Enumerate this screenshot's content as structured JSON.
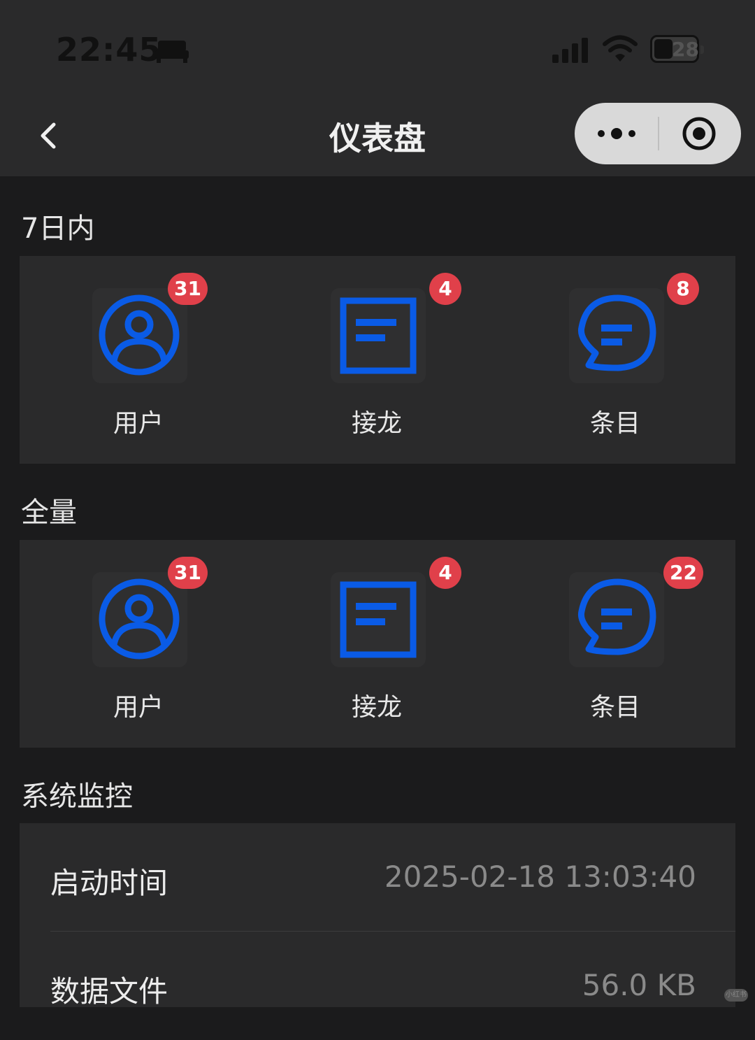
{
  "status_bar": {
    "time": "22:45",
    "battery_level": "28",
    "icons": [
      "bed-icon",
      "signal-icon",
      "wifi-icon",
      "battery-icon"
    ]
  },
  "nav": {
    "title": "仪表盘",
    "back_icon": "chevron-left-icon",
    "more_icon": "more-dots-icon",
    "close_icon": "target-icon"
  },
  "sections": [
    {
      "title": "7日内",
      "cards": [
        {
          "label": "用户",
          "badge": "31",
          "icon": "user-icon"
        },
        {
          "label": "接龙",
          "badge": "4",
          "icon": "document-icon"
        },
        {
          "label": "条目",
          "badge": "8",
          "icon": "chat-icon"
        }
      ]
    },
    {
      "title": "全量",
      "cards": [
        {
          "label": "用户",
          "badge": "31",
          "icon": "user-icon"
        },
        {
          "label": "接龙",
          "badge": "4",
          "icon": "document-icon"
        },
        {
          "label": "条目",
          "badge": "22",
          "icon": "chat-icon"
        }
      ]
    }
  ],
  "monitor": {
    "title": "系统监控",
    "rows": [
      {
        "label": "启动时间",
        "value": "2025-02-18 13:03:40"
      },
      {
        "label": "数据文件",
        "value": "56.0 KB"
      }
    ]
  },
  "watermark": "小红书",
  "colors": {
    "accent_blue": "#0a5be6",
    "badge_red": "#e0404a",
    "background": "#1b1b1c",
    "panel": "#2a2a2b"
  }
}
